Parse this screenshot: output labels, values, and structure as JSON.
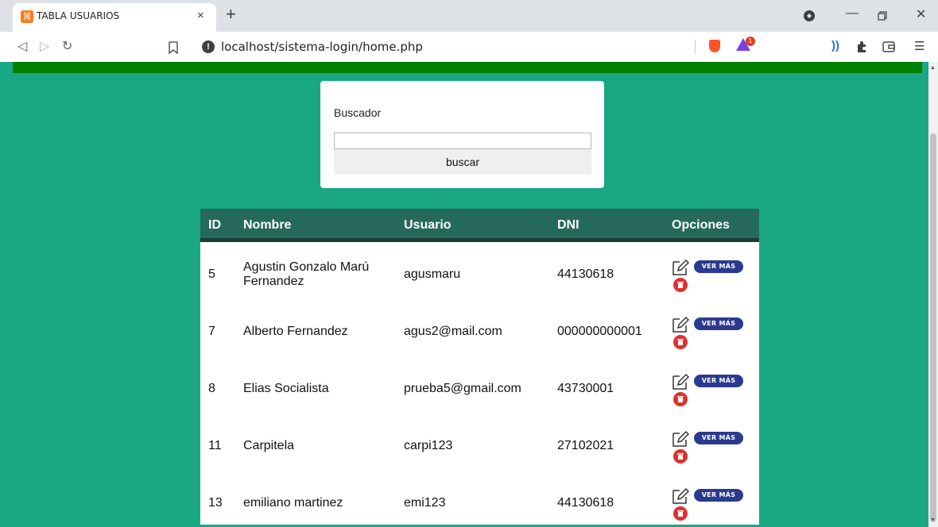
{
  "browser": {
    "tab_title": "TABLA USUARIOS",
    "tab_favicon": "xampp-icon",
    "close_tab": "×",
    "new_tab": "+",
    "url": "localhost/sistema-login/home.php"
  },
  "search": {
    "label": "Buscador",
    "value": "",
    "button": "buscar"
  },
  "table": {
    "headers": [
      "ID",
      "Nombre",
      "Usuario",
      "DNI",
      "Opciones"
    ],
    "rows": [
      {
        "id": "5",
        "nombre": "Agustin Gonzalo Marú Fernandez",
        "usuario": "agusmaru",
        "dni": "44130618"
      },
      {
        "id": "7",
        "nombre": "Alberto Fernandez",
        "usuario": "agus2@mail.com",
        "dni": "000000000001"
      },
      {
        "id": "8",
        "nombre": "Elias Socialista",
        "usuario": "prueba5@gmail.com",
        "dni": "43730001"
      },
      {
        "id": "11",
        "nombre": "Carpitela",
        "usuario": "carpi123",
        "dni": "27102021"
      },
      {
        "id": "13",
        "nombre": "emiliano martinez",
        "usuario": "emi123",
        "dni": "44130618"
      }
    ],
    "ver_mas_label": "VER MÁS"
  },
  "colors": {
    "page_bg": "#1aa784",
    "top_bar": "#008000",
    "table_header": "#24695c",
    "ver_mas": "#2b3a8f",
    "delete": "#e03030"
  }
}
